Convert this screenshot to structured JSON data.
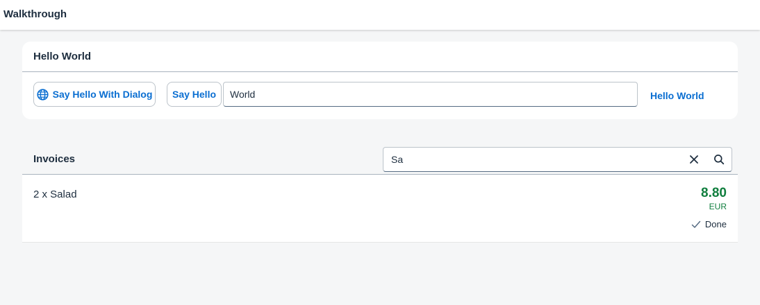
{
  "shell": {
    "title": "Walkthrough"
  },
  "hello_panel": {
    "title": "Hello World",
    "dialog_button_label": "Say Hello With Dialog",
    "dialog_button_icon": "globe-icon",
    "hello_button_label": "Say Hello",
    "name_input_value": "World",
    "greeting_text": "Hello World"
  },
  "invoices": {
    "title": "Invoices",
    "search_value": "Sa",
    "clear_icon": "close-icon",
    "search_icon": "search-icon",
    "items": [
      {
        "title": "2 x Salad",
        "amount": "8.80",
        "currency": "EUR",
        "status": "Done",
        "status_icon": "checkmark-icon"
      }
    ]
  },
  "colors": {
    "accent": "#0a6ed1",
    "positive": "#107e3e",
    "background": "#f5f6f7"
  }
}
